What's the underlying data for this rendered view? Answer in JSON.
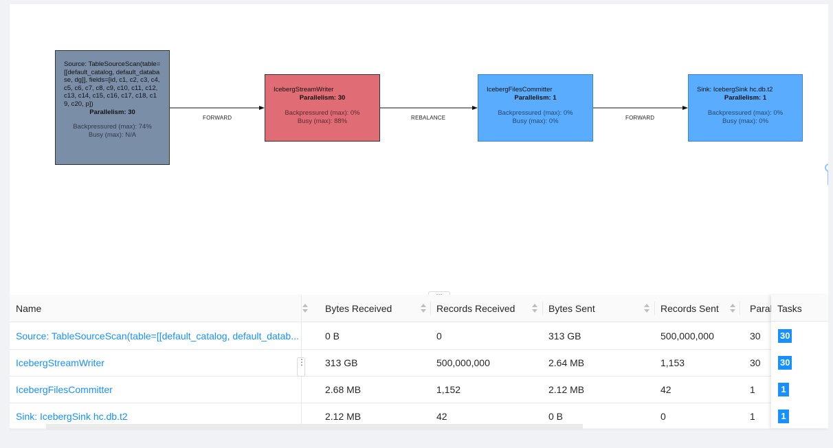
{
  "graph": {
    "nodes": [
      {
        "title": "Source: TableSourceScan(table=[[default_catalog, default_database, dg]], fields=[id, c1, c2, c3, c4, c5, c6, c7, c8, c9, c10, c11, c12, c13, c14, c15, c16, c17, c18, c19, c20, p])",
        "parallelism": "Parallelism: 30",
        "backpressured": "Backpressured (max): 74%",
        "busy": "Busy (max): N/A",
        "color": "#7b8ea8"
      },
      {
        "title": "IcebergStreamWriter",
        "parallelism": "Parallelism: 30",
        "backpressured": "Backpressured (max): 0%",
        "busy": "Busy (max): 88%",
        "color": "#e06c75"
      },
      {
        "title": "IcebergFilesCommitter",
        "parallelism": "Parallelism: 1",
        "backpressured": "Backpressured (max): 0%",
        "busy": "Busy (max): 0%",
        "color": "#5aacff"
      },
      {
        "title": "Sink: IcebergSink hc.db.t2",
        "parallelism": "Parallelism: 1",
        "backpressured": "Backpressured (max): 0%",
        "busy": "Busy (max): 0%",
        "color": "#5aacff"
      }
    ],
    "edges": [
      "FORWARD",
      "REBALANCE",
      "FORWARD"
    ]
  },
  "splitter_label": "···",
  "table": {
    "columns": [
      "Name",
      "Bytes Received",
      "Records Received",
      "Bytes Sent",
      "Records Sent",
      "Paral",
      "Tasks"
    ],
    "rows": [
      {
        "name": "Source: TableSourceScan(table=[[default_catalog, default_datab...",
        "bytes_received": "0 B",
        "records_received": "0",
        "bytes_sent": "313 GB",
        "records_sent": "500,000,000",
        "parallelism": "30",
        "tasks": "30"
      },
      {
        "name": "IcebergStreamWriter",
        "bytes_received": "313 GB",
        "records_received": "500,000,000",
        "bytes_sent": "2.64 MB",
        "records_sent": "1,153",
        "parallelism": "30",
        "tasks": "30"
      },
      {
        "name": "IcebergFilesCommitter",
        "bytes_received": "2.68 MB",
        "records_received": "1,152",
        "bytes_sent": "2.12 MB",
        "records_sent": "42",
        "parallelism": "1",
        "tasks": "1"
      },
      {
        "name": "Sink: IcebergSink hc.db.t2",
        "bytes_received": "2.12 MB",
        "records_received": "42",
        "bytes_sent": "0 B",
        "records_sent": "0",
        "parallelism": "1",
        "tasks": "1"
      }
    ],
    "column_menu_icon": "more-vertical-icon"
  },
  "colors": {
    "link": "#1890ff",
    "badge": "#1890ff"
  }
}
